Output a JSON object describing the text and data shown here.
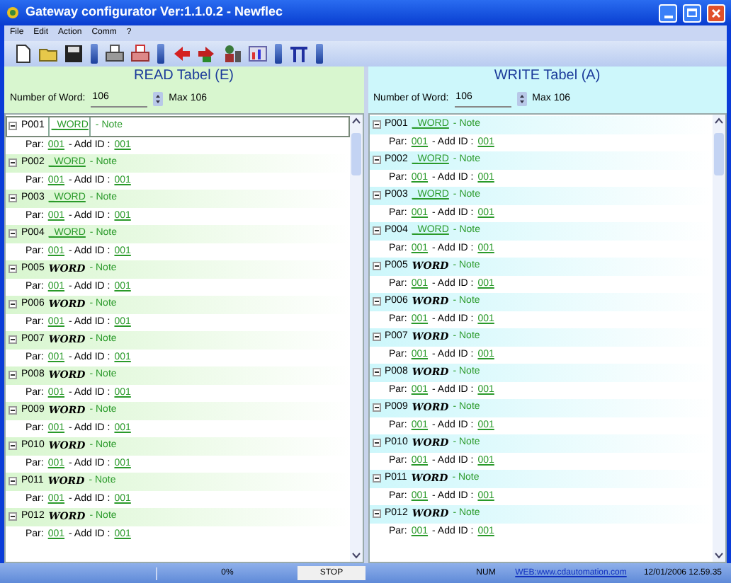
{
  "window": {
    "title": "Gateway configurator Ver:1.1.0.2 - Newflec"
  },
  "menu": [
    "File",
    "Edit",
    "Action",
    "Comm",
    "?"
  ],
  "toolbar": [
    {
      "kind": "new"
    },
    {
      "kind": "open"
    },
    {
      "kind": "save"
    },
    {
      "kind": "sep"
    },
    {
      "kind": "print"
    },
    {
      "kind": "print-red"
    },
    {
      "kind": "sep"
    },
    {
      "kind": "arrow-red"
    },
    {
      "kind": "arrow-green"
    },
    {
      "kind": "person"
    },
    {
      "kind": "chart"
    },
    {
      "kind": "sep"
    },
    {
      "kind": "pi"
    },
    {
      "kind": "sep"
    }
  ],
  "panels": [
    {
      "title": "READ Tabel (E)",
      "color": "#d8f6cf",
      "number_label": "Number of Word:",
      "number_value": "106",
      "max_label": "Max 106",
      "items": [
        {
          "code": "P001",
          "word": "_WORD",
          "kind": "link",
          "note": "- Note",
          "selected": true,
          "par_label": "Par:",
          "par": "001",
          "addid_label": "- Add ID :",
          "addid": "001"
        },
        {
          "code": "P002",
          "word": "_WORD",
          "kind": "link",
          "note": "- Note",
          "selected": false,
          "par_label": "Par:",
          "par": "001",
          "addid_label": "- Add ID :",
          "addid": "001"
        },
        {
          "code": "P003",
          "word": "_WORD",
          "kind": "link",
          "note": "- Note",
          "selected": false,
          "par_label": "Par:",
          "par": "001",
          "addid_label": "- Add ID :",
          "addid": "001"
        },
        {
          "code": "P004",
          "word": "_WORD",
          "kind": "link",
          "note": "- Note",
          "selected": false,
          "par_label": "Par:",
          "par": "001",
          "addid_label": "- Add ID :",
          "addid": "001"
        },
        {
          "code": "P005",
          "word": "WORD",
          "kind": "bold",
          "note": "- Note",
          "selected": false,
          "par_label": "Par:",
          "par": "001",
          "addid_label": "- Add ID :",
          "addid": "001"
        },
        {
          "code": "P006",
          "word": "WORD",
          "kind": "bold",
          "note": "- Note",
          "selected": false,
          "par_label": "Par:",
          "par": "001",
          "addid_label": "- Add ID :",
          "addid": "001"
        },
        {
          "code": "P007",
          "word": "WORD",
          "kind": "bold",
          "note": "- Note",
          "selected": false,
          "par_label": "Par:",
          "par": "001",
          "addid_label": "- Add ID :",
          "addid": "001"
        },
        {
          "code": "P008",
          "word": "WORD",
          "kind": "bold",
          "note": "- Note",
          "selected": false,
          "par_label": "Par:",
          "par": "001",
          "addid_label": "- Add ID :",
          "addid": "001"
        },
        {
          "code": "P009",
          "word": "WORD",
          "kind": "bold",
          "note": "- Note",
          "selected": false,
          "par_label": "Par:",
          "par": "001",
          "addid_label": "- Add ID :",
          "addid": "001"
        },
        {
          "code": "P010",
          "word": "WORD",
          "kind": "bold",
          "note": "- Note",
          "selected": false,
          "par_label": "Par:",
          "par": "001",
          "addid_label": "- Add ID :",
          "addid": "001"
        },
        {
          "code": "P011",
          "word": "WORD",
          "kind": "bold",
          "note": "- Note",
          "selected": false,
          "par_label": "Par:",
          "par": "001",
          "addid_label": "- Add ID :",
          "addid": "001"
        },
        {
          "code": "P012",
          "word": "WORD",
          "kind": "bold",
          "note": "- Note",
          "selected": false,
          "par_label": "Par:",
          "par": "001",
          "addid_label": "- Add ID :",
          "addid": "001"
        }
      ]
    },
    {
      "title": "WRITE Tabel (A)",
      "color": "#cdf7fb",
      "number_label": "Number of Word:",
      "number_value": "106",
      "max_label": "Max 106",
      "items": [
        {
          "code": "P001",
          "word": "_WORD",
          "kind": "link",
          "note": "- Note",
          "selected": false,
          "par_label": "Par:",
          "par": "001",
          "addid_label": "- Add ID :",
          "addid": "001"
        },
        {
          "code": "P002",
          "word": "_WORD",
          "kind": "link",
          "note": "- Note",
          "selected": false,
          "par_label": "Par:",
          "par": "001",
          "addid_label": "- Add ID :",
          "addid": "001"
        },
        {
          "code": "P003",
          "word": "_WORD",
          "kind": "link",
          "note": "- Note",
          "selected": false,
          "par_label": "Par:",
          "par": "001",
          "addid_label": "- Add ID :",
          "addid": "001"
        },
        {
          "code": "P004",
          "word": "_WORD",
          "kind": "link",
          "note": "- Note",
          "selected": false,
          "par_label": "Par:",
          "par": "001",
          "addid_label": "- Add ID :",
          "addid": "001"
        },
        {
          "code": "P005",
          "word": "WORD",
          "kind": "bold",
          "note": "- Note",
          "selected": false,
          "par_label": "Par:",
          "par": "001",
          "addid_label": "- Add ID :",
          "addid": "001"
        },
        {
          "code": "P006",
          "word": "WORD",
          "kind": "bold",
          "note": "- Note",
          "selected": false,
          "par_label": "Par:",
          "par": "001",
          "addid_label": "- Add ID :",
          "addid": "001"
        },
        {
          "code": "P007",
          "word": "WORD",
          "kind": "bold",
          "note": "- Note",
          "selected": false,
          "par_label": "Par:",
          "par": "001",
          "addid_label": "- Add ID :",
          "addid": "001"
        },
        {
          "code": "P008",
          "word": "WORD",
          "kind": "bold",
          "note": "- Note",
          "selected": false,
          "par_label": "Par:",
          "par": "001",
          "addid_label": "- Add ID :",
          "addid": "001"
        },
        {
          "code": "P009",
          "word": "WORD",
          "kind": "bold",
          "note": "- Note",
          "selected": false,
          "par_label": "Par:",
          "par": "001",
          "addid_label": "- Add ID :",
          "addid": "001"
        },
        {
          "code": "P010",
          "word": "WORD",
          "kind": "bold",
          "note": "- Note",
          "selected": false,
          "par_label": "Par:",
          "par": "001",
          "addid_label": "- Add ID :",
          "addid": "001"
        },
        {
          "code": "P011",
          "word": "WORD",
          "kind": "bold",
          "note": "- Note",
          "selected": false,
          "par_label": "Par:",
          "par": "001",
          "addid_label": "- Add ID :",
          "addid": "001"
        },
        {
          "code": "P012",
          "word": "WORD",
          "kind": "bold",
          "note": "- Note",
          "selected": false,
          "par_label": "Par:",
          "par": "001",
          "addid_label": "- Add ID :",
          "addid": "001"
        }
      ]
    }
  ],
  "status_bar": {
    "progress": "0%",
    "stop": "STOP",
    "num": "NUM",
    "web": "WEB:www.cdautomation.com",
    "datetime": "12/01/2006 12.59.35"
  }
}
